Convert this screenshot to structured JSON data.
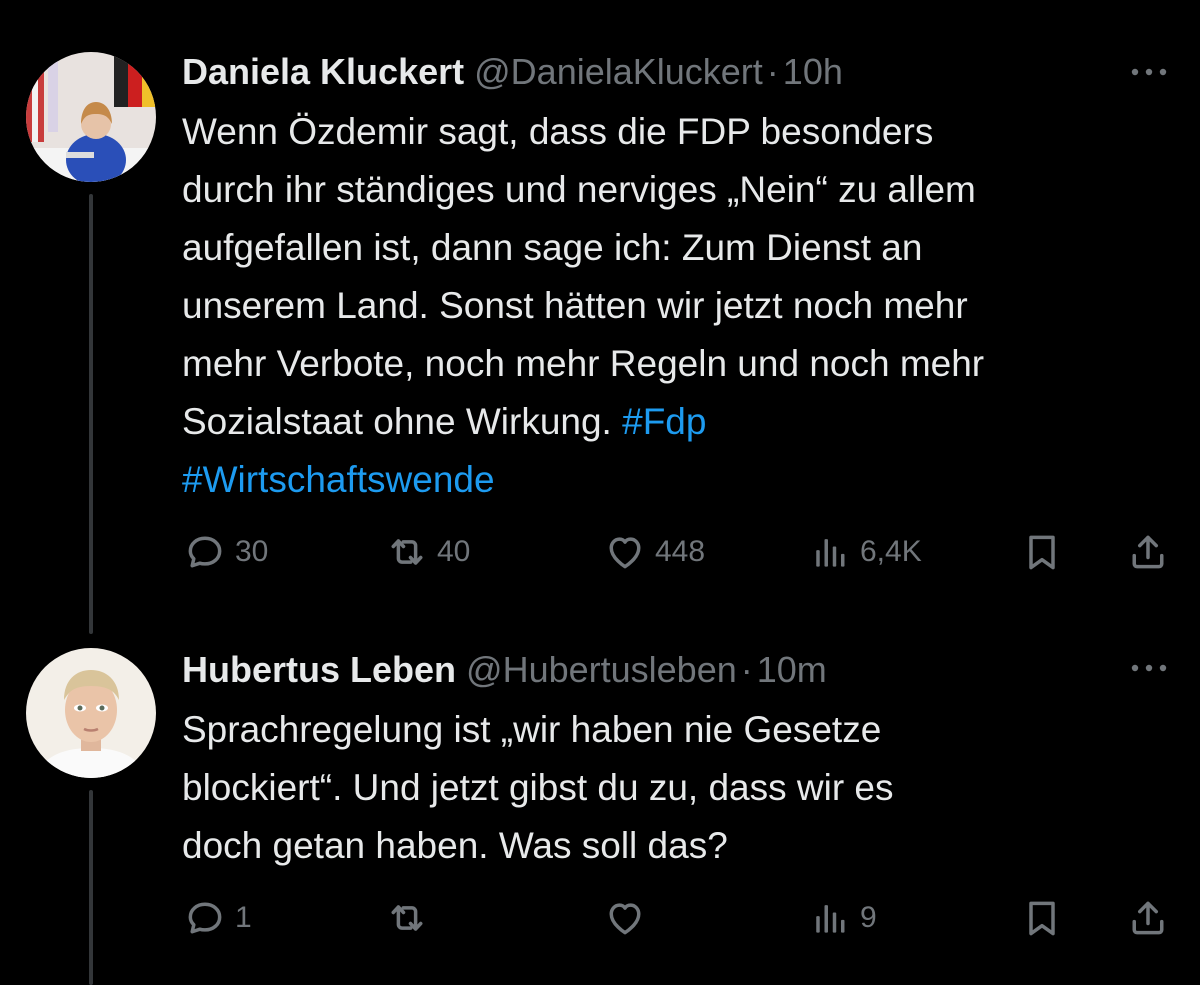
{
  "tweets": [
    {
      "author_name": "Daniela Kluckert",
      "handle": "@DanielaKluckert",
      "separator": "·",
      "time": "10h",
      "more_icon": "more-horizontal-icon",
      "text": "Wenn Özdemir sagt, dass die FDP besonders\ndurch ihr ständiges und nerviges „Nein“ zu allem\naufgefallen ist, dann sage ich: Zum Dienst an\nunserem Land. Sonst hätten wir jetzt noch mehr\nmehr Verbote, noch mehr Regeln und noch mehr\nSozialstaat ohne Wirkung. ",
      "hashtags": [
        "#Fdp",
        "#Wirtschaftswende"
      ],
      "replies": "30",
      "reposts": "40",
      "likes": "448",
      "views": "6,4K"
    },
    {
      "author_name": "Hubertus Leben",
      "handle": "@Hubertusleben",
      "separator": "·",
      "time": "10m",
      "more_icon": "more-horizontal-icon",
      "text": "Sprachregelung ist „wir haben nie Gesetze\nblockiert“. Und jetzt gibst du zu, dass wir es\ndoch getan haben. Was soll das?",
      "replies": "1",
      "reposts": "",
      "likes": "",
      "views": "9"
    }
  ],
  "colors": {
    "background": "#000000",
    "text": "#e7e9ea",
    "secondary": "#71767b",
    "link": "#1d9bf0",
    "thread_line": "#333639"
  },
  "icons": [
    "reply-icon",
    "repost-icon",
    "like-icon",
    "views-icon",
    "bookmark-icon",
    "share-icon"
  ]
}
